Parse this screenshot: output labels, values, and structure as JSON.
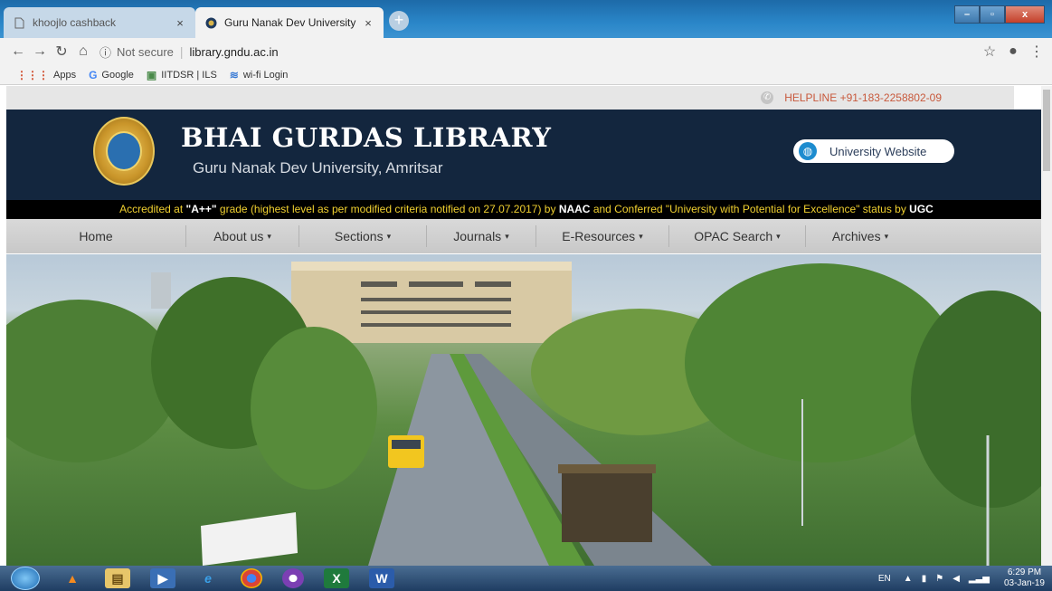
{
  "browser": {
    "tabs": [
      {
        "title": "khoojlo cashback",
        "active": false
      },
      {
        "title": "Guru Nanak Dev University",
        "active": true
      }
    ],
    "new_tab_symbol": "+",
    "window_controls": {
      "minimize": "–",
      "maximize": "▫",
      "close": "x"
    },
    "address": {
      "security_text": "Not secure",
      "url": "library.gndu.ac.in"
    },
    "bookmarks": [
      {
        "label": "Apps",
        "icon": "apps-grid-icon"
      },
      {
        "label": "Google",
        "icon": "google-icon"
      },
      {
        "label": "IITDSR | ILS",
        "icon": "ils-icon"
      },
      {
        "label": "wi-fi Login",
        "icon": "wifi-icon"
      }
    ]
  },
  "site": {
    "helpline": "HELPLINE +91-183-2258802-09",
    "title": "BHAI GURDAS LIBRARY",
    "subtitle": "Guru Nanak Dev University, Amritsar",
    "university_website": "University Website",
    "accreditation": {
      "p1": "Accredited at ",
      "grade": "\"A++\"",
      "p2": " grade (highest level as per modified criteria notified on 27.07.2017) by ",
      "naac": "NAAC",
      "p3": " and Conferred \"University with Potential for Excellence\" status by ",
      "ugc": "UGC"
    },
    "nav": [
      {
        "label": "Home",
        "dropdown": false
      },
      {
        "label": "About us",
        "dropdown": true
      },
      {
        "label": "Sections",
        "dropdown": true
      },
      {
        "label": "Journals",
        "dropdown": true
      },
      {
        "label": "E-Resources",
        "dropdown": true
      },
      {
        "label": "OPAC Search",
        "dropdown": true
      },
      {
        "label": "Archives",
        "dropdown": true
      }
    ]
  },
  "taskbar": {
    "language": "EN",
    "time": "6:29 PM",
    "date": "03-Jan-19"
  },
  "colors": {
    "header_bg": "#13263e",
    "accreditation_text": "#f0d030",
    "helpline_text": "#c8593c",
    "nav_bg": "#d0d0d0"
  }
}
